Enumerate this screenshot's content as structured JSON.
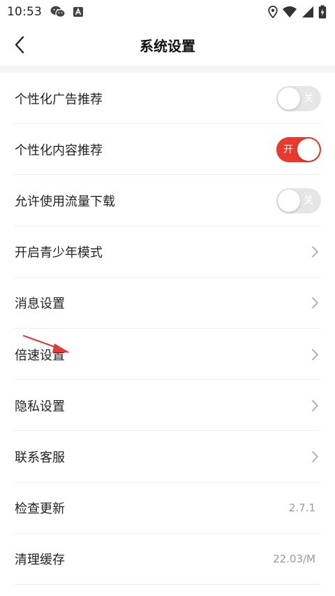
{
  "status_bar": {
    "time": "10:53",
    "left_icons": [
      "wechat-icon",
      "a-badge-icon"
    ],
    "right_icons": [
      "location-icon",
      "wifi-icon",
      "signal-icon",
      "battery-charging-icon"
    ]
  },
  "header": {
    "title": "系统设置",
    "back_icon": "chevron-left-icon"
  },
  "settings": {
    "items": [
      {
        "label": "个性化广告推荐",
        "type": "toggle",
        "state": "off",
        "toggle_text": "关"
      },
      {
        "label": "个性化内容推荐",
        "type": "toggle",
        "state": "on",
        "toggle_text": "开"
      },
      {
        "label": "允许使用流量下载",
        "type": "toggle",
        "state": "off",
        "toggle_text": "关"
      },
      {
        "label": "开启青少年模式",
        "type": "link"
      },
      {
        "label": "消息设置",
        "type": "link"
      },
      {
        "label": "倍速设置",
        "type": "link"
      },
      {
        "label": "隐私设置",
        "type": "link"
      },
      {
        "label": "联系客服",
        "type": "link"
      },
      {
        "label": "检查更新",
        "type": "value",
        "value": "2.7.1"
      },
      {
        "label": "清理缓存",
        "type": "value",
        "value": "22.03/M"
      }
    ]
  },
  "colors": {
    "accent": "#e8392c",
    "toggle_off": "#e6e6e6",
    "text_primary": "#222222",
    "text_secondary": "#999999",
    "annotation_arrow": "#e53935"
  }
}
